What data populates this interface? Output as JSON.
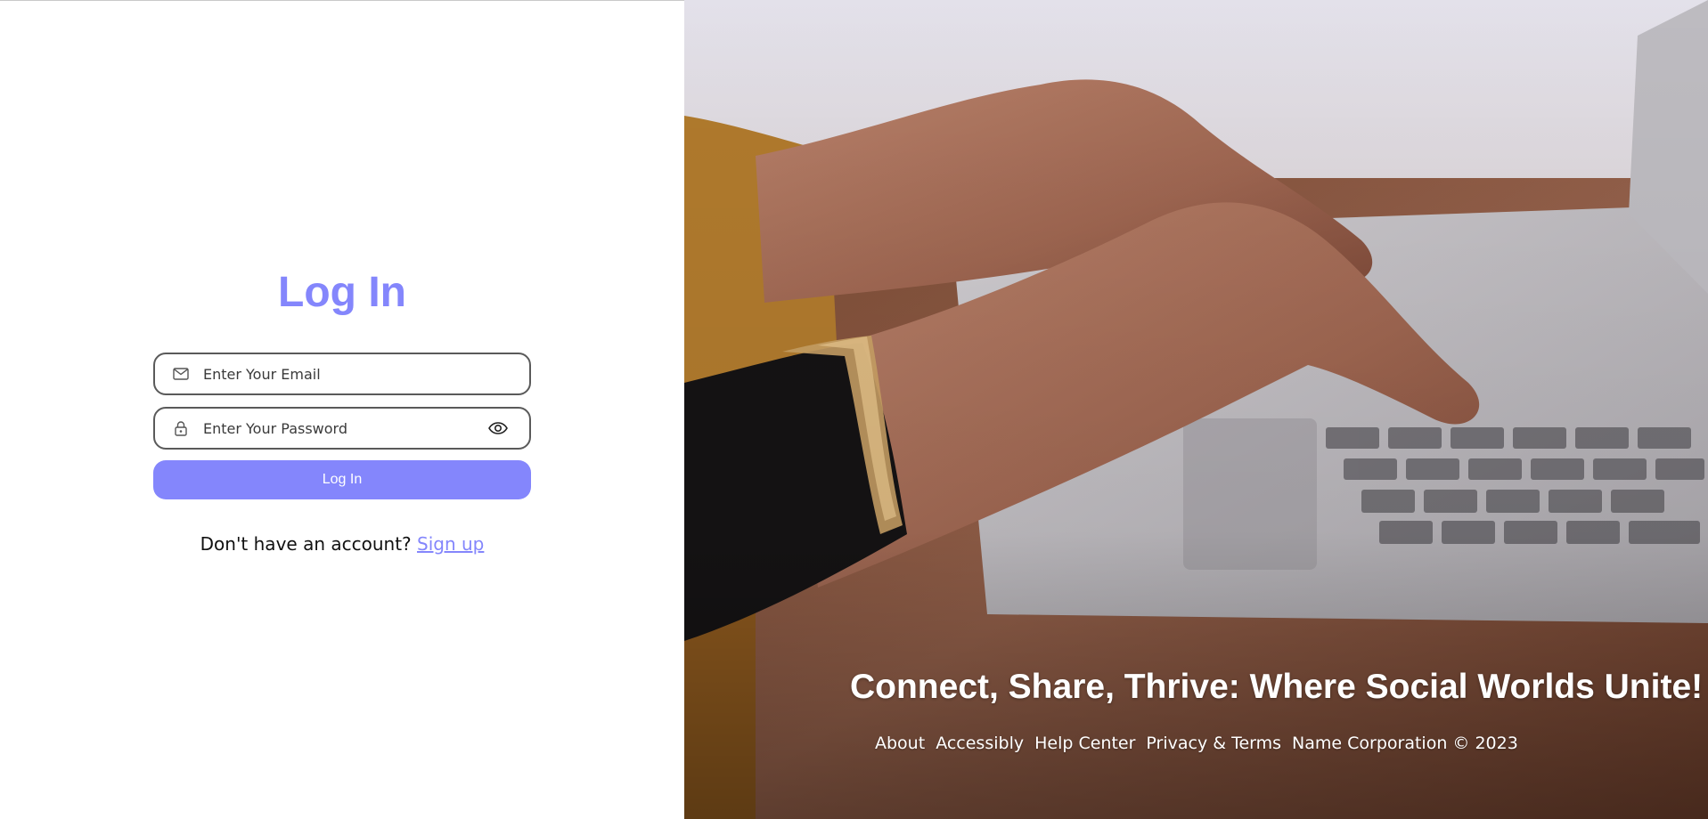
{
  "login": {
    "title": "Log In",
    "email_placeholder": "Enter Your Email",
    "password_placeholder": "Enter Your Password",
    "submit_label": "Log In",
    "signup_prompt": "Don't have an account?",
    "signup_link": "Sign up"
  },
  "hero": {
    "tagline": "Connect, Share, Thrive: Where Social Worlds Unite!",
    "footer_links": [
      "About",
      "Accessibly",
      "Help Center",
      "Privacy & Terms"
    ],
    "copyright": "Name Corporation © 2023"
  },
  "icons": {
    "email": "mail-icon",
    "password": "lock-icon",
    "toggle": "eye-icon"
  },
  "colors": {
    "accent": "#8486fc",
    "field_border": "#5a5a5a",
    "text": "#111111"
  }
}
